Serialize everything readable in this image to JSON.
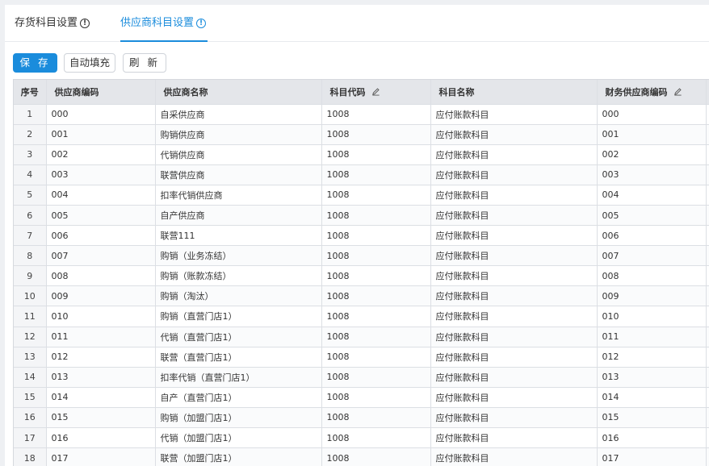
{
  "tabs": [
    {
      "label": "存货科目设置",
      "active": false
    },
    {
      "label": "供应商科目设置",
      "active": true
    }
  ],
  "toolbar": {
    "save_label": "保 存",
    "auto_fill_label": "自动填充",
    "refresh_label": "刷 新"
  },
  "columns": {
    "index": "序号",
    "supplier_code": "供应商编码",
    "supplier_name": "供应商名称",
    "account_code": "科目代码",
    "account_name": "科目名称",
    "finance_supplier_code": "财务供应商编码"
  },
  "icons": {
    "tab_info": "info-circle-icon",
    "editable_column": "pencil-icon"
  },
  "colors": {
    "accent": "#1a8cdc",
    "header_bg": "#e4e6ea"
  },
  "rows": [
    {
      "index": "1",
      "supplier_code": "000",
      "supplier_name": "自采供应商",
      "account_code": "1008",
      "account_name": "应付账款科目",
      "finance_supplier_code": "000"
    },
    {
      "index": "2",
      "supplier_code": "001",
      "supplier_name": "购销供应商",
      "account_code": "1008",
      "account_name": "应付账款科目",
      "finance_supplier_code": "001"
    },
    {
      "index": "3",
      "supplier_code": "002",
      "supplier_name": "代销供应商",
      "account_code": "1008",
      "account_name": "应付账款科目",
      "finance_supplier_code": "002"
    },
    {
      "index": "4",
      "supplier_code": "003",
      "supplier_name": "联营供应商",
      "account_code": "1008",
      "account_name": "应付账款科目",
      "finance_supplier_code": "003"
    },
    {
      "index": "5",
      "supplier_code": "004",
      "supplier_name": "扣率代销供应商",
      "account_code": "1008",
      "account_name": "应付账款科目",
      "finance_supplier_code": "004"
    },
    {
      "index": "6",
      "supplier_code": "005",
      "supplier_name": "自产供应商",
      "account_code": "1008",
      "account_name": "应付账款科目",
      "finance_supplier_code": "005"
    },
    {
      "index": "7",
      "supplier_code": "006",
      "supplier_name": "联营111",
      "account_code": "1008",
      "account_name": "应付账款科目",
      "finance_supplier_code": "006"
    },
    {
      "index": "8",
      "supplier_code": "007",
      "supplier_name": "购销（业务冻结）",
      "account_code": "1008",
      "account_name": "应付账款科目",
      "finance_supplier_code": "007"
    },
    {
      "index": "9",
      "supplier_code": "008",
      "supplier_name": "购销（账款冻结）",
      "account_code": "1008",
      "account_name": "应付账款科目",
      "finance_supplier_code": "008"
    },
    {
      "index": "10",
      "supplier_code": "009",
      "supplier_name": "购销（淘汰）",
      "account_code": "1008",
      "account_name": "应付账款科目",
      "finance_supplier_code": "009"
    },
    {
      "index": "11",
      "supplier_code": "010",
      "supplier_name": "购销（直营门店1）",
      "account_code": "1008",
      "account_name": "应付账款科目",
      "finance_supplier_code": "010"
    },
    {
      "index": "12",
      "supplier_code": "011",
      "supplier_name": "代销（直营门店1）",
      "account_code": "1008",
      "account_name": "应付账款科目",
      "finance_supplier_code": "011"
    },
    {
      "index": "13",
      "supplier_code": "012",
      "supplier_name": "联营（直营门店1）",
      "account_code": "1008",
      "account_name": "应付账款科目",
      "finance_supplier_code": "012"
    },
    {
      "index": "14",
      "supplier_code": "013",
      "supplier_name": "扣率代销（直营门店1）",
      "account_code": "1008",
      "account_name": "应付账款科目",
      "finance_supplier_code": "013"
    },
    {
      "index": "15",
      "supplier_code": "014",
      "supplier_name": "自产（直营门店1）",
      "account_code": "1008",
      "account_name": "应付账款科目",
      "finance_supplier_code": "014"
    },
    {
      "index": "16",
      "supplier_code": "015",
      "supplier_name": "购销（加盟门店1）",
      "account_code": "1008",
      "account_name": "应付账款科目",
      "finance_supplier_code": "015"
    },
    {
      "index": "17",
      "supplier_code": "016",
      "supplier_name": "代销（加盟门店1）",
      "account_code": "1008",
      "account_name": "应付账款科目",
      "finance_supplier_code": "016"
    },
    {
      "index": "18",
      "supplier_code": "017",
      "supplier_name": "联营（加盟门店1）",
      "account_code": "1008",
      "account_name": "应付账款科目",
      "finance_supplier_code": "017"
    }
  ]
}
